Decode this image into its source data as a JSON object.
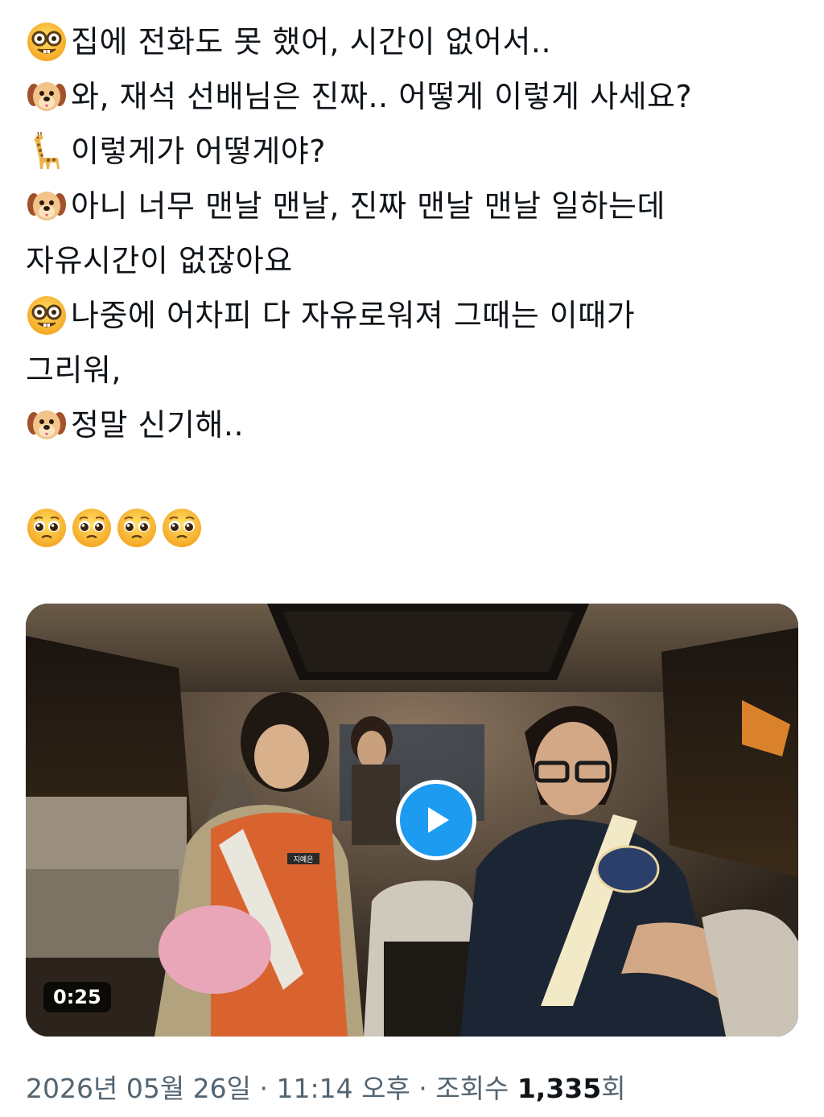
{
  "tweet": {
    "lines": [
      {
        "emoji": "nerd-face",
        "text": "집에 전화도 못 했어, 시간이 없어서.."
      },
      {
        "emoji": "dog-face",
        "text": "와, 재석 선배님은 진짜.. 어떻게 이렇게 사세요?"
      },
      {
        "emoji": "giraffe",
        "text": "이렇게가 어떻게야?"
      },
      {
        "emoji": "dog-face",
        "text": "아니 너무 맨날 맨날, 진짜 맨날 맨날 일하는데"
      },
      {
        "emoji": "",
        "text": "자유시간이 없잖아요"
      },
      {
        "emoji": "nerd-face",
        "text": "나중에 어차피 다 자유로워져 그때는 이때가"
      },
      {
        "emoji": "",
        "text": "그리워,"
      },
      {
        "emoji": "dog-face",
        "text": "정말 신기해.."
      }
    ],
    "reaction_emojis": [
      "pleading-face",
      "pleading-face",
      "pleading-face",
      "pleading-face"
    ]
  },
  "video": {
    "duration": "0:25",
    "play_icon": "play-icon",
    "jersey_name": "지예은"
  },
  "meta": {
    "date_time": "2026년 05월 26일 · 11:14 오후 · 조회수 ",
    "views": "1,335",
    "views_unit": "회"
  },
  "colors": {
    "text": "#0f1419",
    "secondary": "#536471",
    "accent": "#1d9bf0"
  }
}
